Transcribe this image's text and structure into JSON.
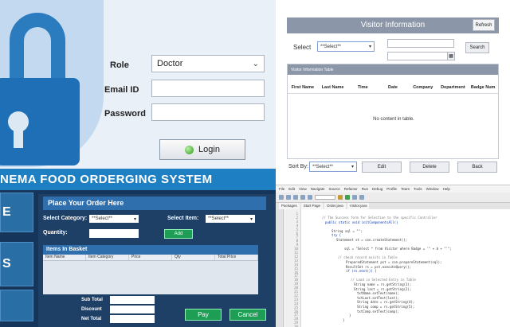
{
  "login": {
    "role_label": "Role",
    "role_value": "Doctor",
    "email_label": "Email ID",
    "email_value": "",
    "password_label": "Password",
    "password_value": "",
    "login_button": "Login"
  },
  "cinema": {
    "title": "NEMA FOOD ORDERGING SYSTEM",
    "side_buttons": [
      "E",
      "S",
      ""
    ],
    "place_order_header": "Place Your Order Here",
    "category_label": "Select Category:",
    "category_value": "**Select**",
    "item_label": "Select Item:",
    "item_value": "**Select**",
    "quantity_label": "Quantity:",
    "add_button": "Add",
    "basket_header": "Items In Basket",
    "basket_columns": [
      "Item Name",
      "Item Category",
      "Price",
      "Qty",
      "Total Price"
    ],
    "subtotal_label": "Sub Total",
    "discount_label": "Discount",
    "net_total_label": "Net Total",
    "pay_button": "Pay",
    "cancel_button": "Cancel"
  },
  "visitor": {
    "title": "Visitor Information",
    "refresh_button": "Refresh",
    "select_label": "Select",
    "select_value": "**Select**",
    "search_button": "Search",
    "table_caption": "Visitor Information Table",
    "columns": [
      "First Name",
      "Last Name",
      "Time",
      "Date",
      "Company",
      "Department",
      "Badge Num"
    ],
    "empty_message": "No content in table.",
    "sort_label": "Sort By:",
    "sort_value": "**Select**",
    "edit_button": "Edit",
    "delete_button": "Delete",
    "back_button": "Back"
  },
  "ide": {
    "menu": [
      "File",
      "Edit",
      "View",
      "Navigate",
      "Source",
      "Refactor",
      "Run",
      "Debug",
      "Profile",
      "Team",
      "Tools",
      "Window",
      "Help"
    ],
    "tabs": [
      "Packages",
      "Start Page",
      "Order.java",
      "Visitor.java"
    ],
    "line_numbers": [
      "1",
      "2",
      "3",
      "4",
      "5",
      "6",
      "7",
      "8",
      "9",
      "10",
      "11",
      "12",
      "13",
      "14",
      "15",
      "16",
      "17",
      "18",
      "19",
      "20",
      "21",
      "22",
      "23",
      "24",
      "25",
      "26",
      "27",
      "28",
      "29",
      "30"
    ],
    "code_lines": [
      "// The Success form for Selection to the specific Controller",
      "public static void initComponentsAll()",
      "",
      "  String sql = \"\";",
      "  try {",
      "    Statement st = con.createStatement();",
      "",
      "    sql = \"Select * from Visitor where Badge = '\" + b + \"'\";",
      "",
      "    // check record exists in Table",
      "    PreparedStatement pst = con.prepareStatement(sql);",
      "    ResultSet rs = pst.executeQuery();",
      "    if (rs.next()) {",
      "",
      "      // Load in Selected Entry in Table",
      "      String name = rs.getString(1);",
      "      String last = rs.getString(2);",
      "      txtName.setText(name);",
      "      txtLast.setText(last);",
      "      String date = rs.getString(4);",
      "      String comp = rs.getString(5);",
      "      txtComp.setText(comp);",
      "    }",
      "  }"
    ]
  },
  "colors": {
    "cinema_bg": "#16355a",
    "cinema_title": "#1f7fc3",
    "accent_green": "#1e9e54",
    "lock_blue": "#1f6fb6",
    "visitor_header": "#8b96a8"
  }
}
